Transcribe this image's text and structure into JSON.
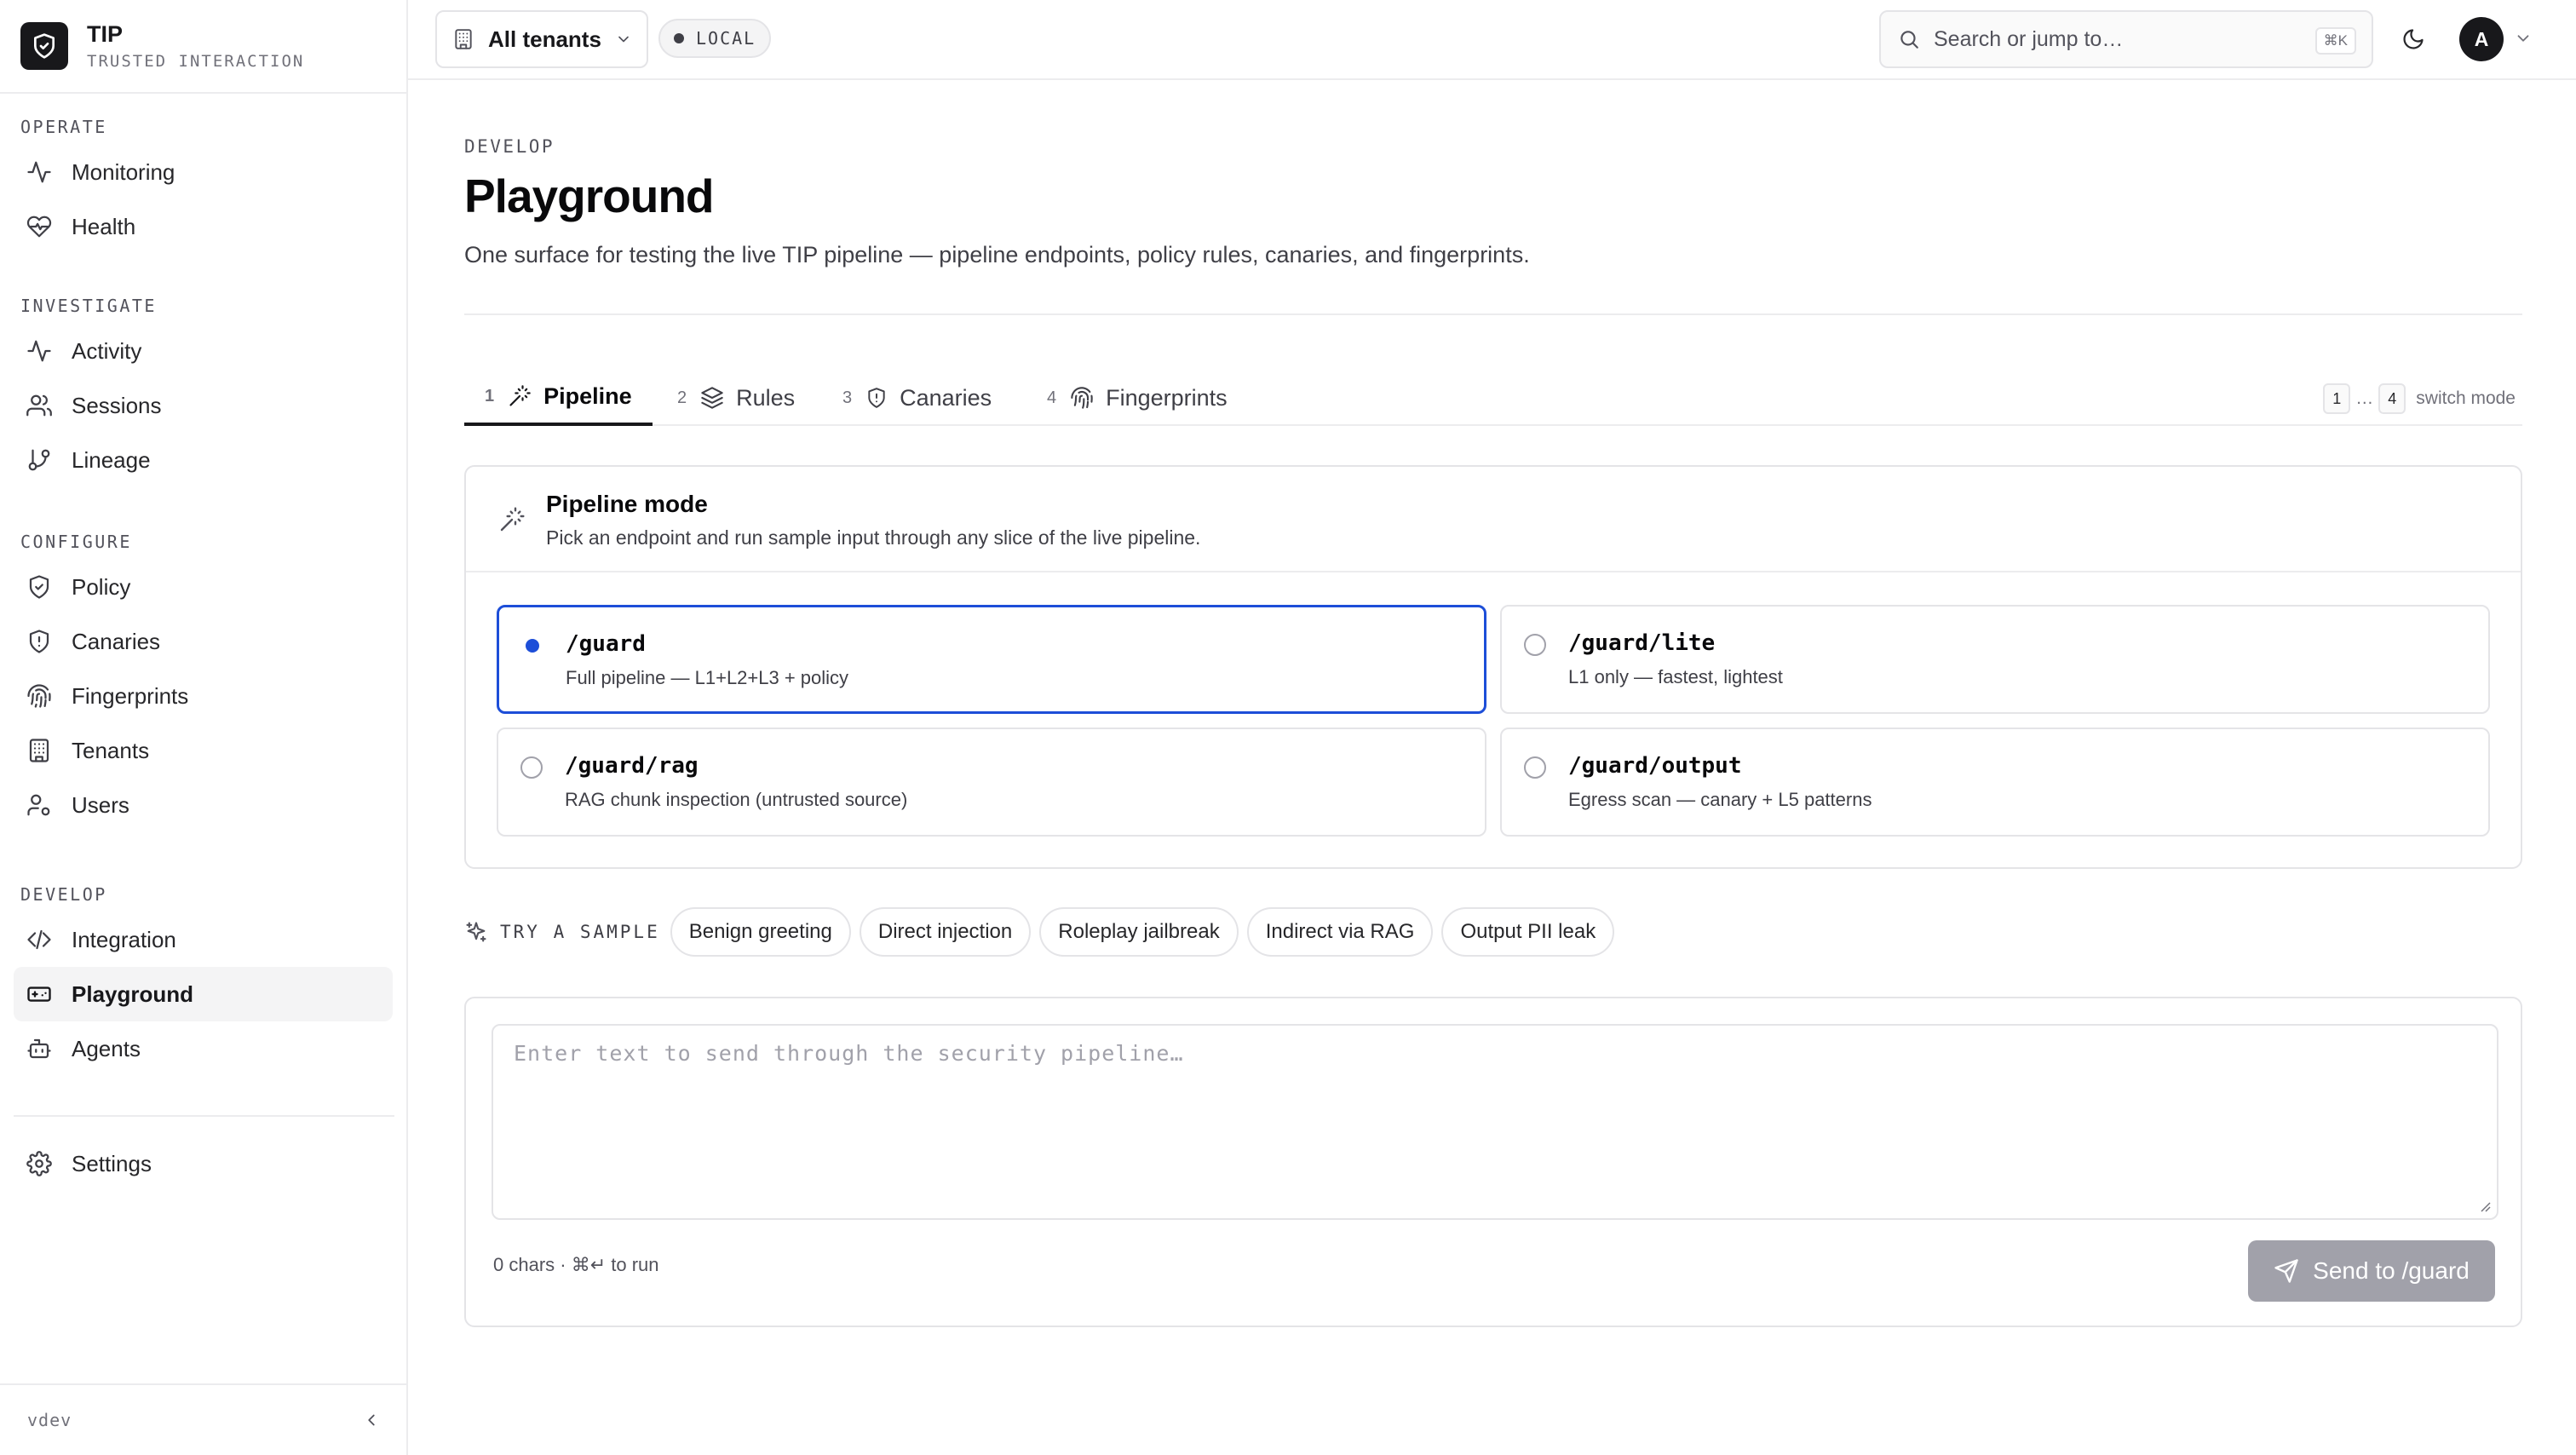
{
  "brand": {
    "name": "TIP",
    "tagline": "TRUSTED INTERACTION"
  },
  "sidebar": {
    "sections": [
      {
        "label": "OPERATE",
        "items": [
          {
            "label": "Monitoring",
            "icon": "activity-icon"
          },
          {
            "label": "Health",
            "icon": "heart-pulse-icon"
          }
        ]
      },
      {
        "label": "INVESTIGATE",
        "items": [
          {
            "label": "Activity",
            "icon": "activity-icon"
          },
          {
            "label": "Sessions",
            "icon": "users-icon"
          },
          {
            "label": "Lineage",
            "icon": "git-branch-icon"
          }
        ]
      },
      {
        "label": "CONFIGURE",
        "items": [
          {
            "label": "Policy",
            "icon": "shield-check-icon"
          },
          {
            "label": "Canaries",
            "icon": "shield-alert-icon"
          },
          {
            "label": "Fingerprints",
            "icon": "fingerprint-icon"
          },
          {
            "label": "Tenants",
            "icon": "building-icon"
          },
          {
            "label": "Users",
            "icon": "user-cog-icon"
          }
        ]
      },
      {
        "label": "DEVELOP",
        "items": [
          {
            "label": "Integration",
            "icon": "code-icon"
          },
          {
            "label": "Playground",
            "icon": "gamepad-icon",
            "active": true
          },
          {
            "label": "Agents",
            "icon": "bot-icon"
          }
        ]
      }
    ],
    "settings_label": "Settings",
    "version": "vdev"
  },
  "topbar": {
    "tenant_label": "All tenants",
    "env_badge": "LOCAL",
    "search_placeholder": "Search or jump to…",
    "search_shortcut": "⌘K",
    "avatar_initial": "A"
  },
  "page": {
    "eyebrow": "DEVELOP",
    "title": "Playground",
    "description": "One surface for testing the live TIP pipeline — pipeline endpoints, policy rules, canaries, and fingerprints."
  },
  "tabs": [
    {
      "num": "1",
      "label": "Pipeline",
      "icon": "wand-icon",
      "active": true
    },
    {
      "num": "2",
      "label": "Rules",
      "icon": "layers-icon"
    },
    {
      "num": "3",
      "label": "Canaries",
      "icon": "shield-alert-icon"
    },
    {
      "num": "4",
      "label": "Fingerprints",
      "icon": "fingerprint-icon"
    }
  ],
  "switch_hint": {
    "from": "1",
    "ellipsis": "…",
    "to": "4",
    "text": "switch mode"
  },
  "mode": {
    "title": "Pipeline mode",
    "subtitle": "Pick an endpoint and run sample input through any slice of the live pipeline.",
    "options": [
      {
        "path": "/guard",
        "desc": "Full pipeline — L1+L2+L3 + policy",
        "selected": true
      },
      {
        "path": "/guard/lite",
        "desc": "L1 only — fastest, lightest",
        "selected": false
      },
      {
        "path": "/guard/rag",
        "desc": "RAG chunk inspection (untrusted source)",
        "selected": false
      },
      {
        "path": "/guard/output",
        "desc": "Egress scan — canary + L5 patterns",
        "selected": false
      }
    ]
  },
  "samples": {
    "label": "TRY A SAMPLE",
    "chips": [
      "Benign greeting",
      "Direct injection",
      "Roleplay jailbreak",
      "Indirect via RAG",
      "Output PII leak"
    ]
  },
  "input": {
    "placeholder": "Enter text to send through the security pipeline…",
    "char_count": "0 chars · ⌘↵ to run",
    "send_label": "Send to /guard"
  },
  "colors": {
    "accent": "#1d4ed8",
    "brand": "#18181b",
    "disabled_button": "#a1a1aa"
  }
}
